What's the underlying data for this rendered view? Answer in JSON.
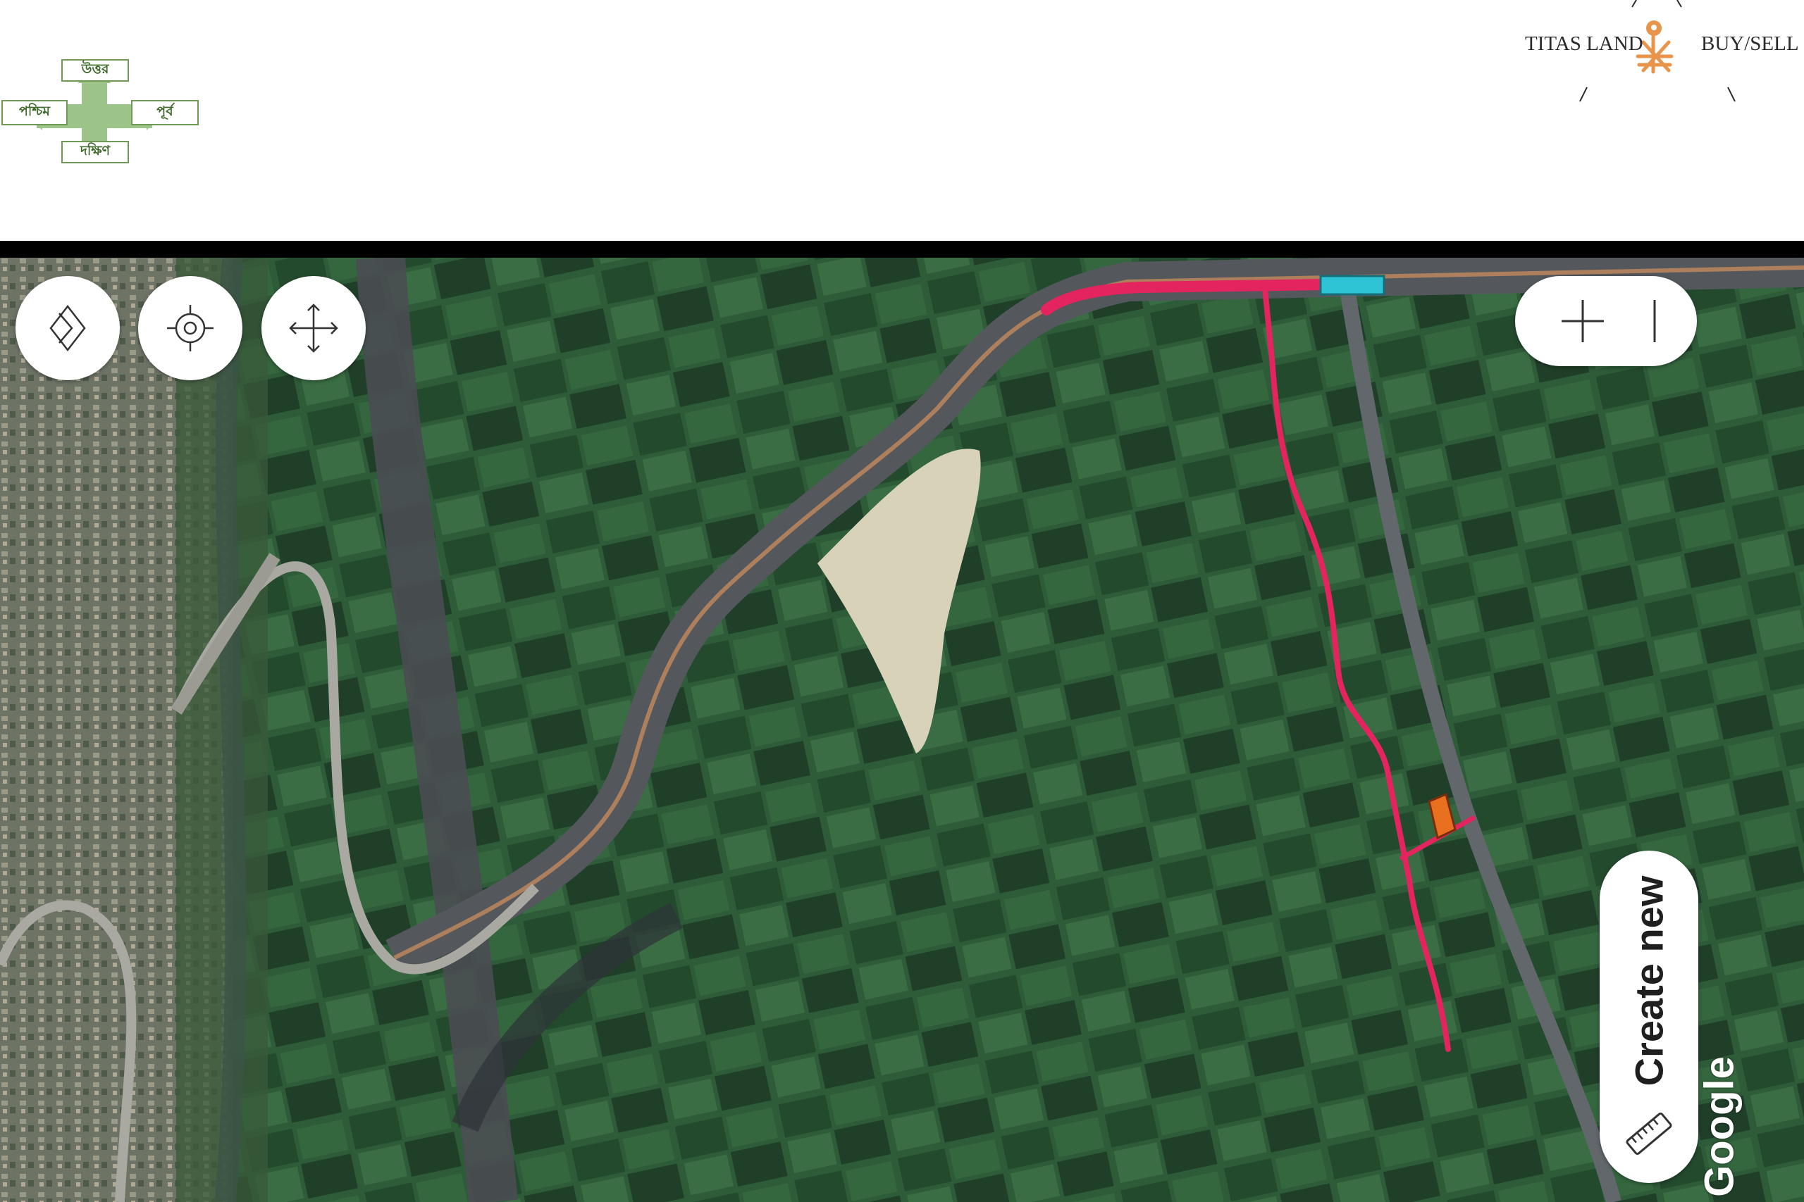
{
  "compass": {
    "north": "উত্তর",
    "south": "দক্ষিণ",
    "east": "পূর্ব",
    "west": "পশ্চিম"
  },
  "logo": {
    "left_text": "TITAS LAND",
    "right_text": "BUY/SELL"
  },
  "map": {
    "type": "satellite",
    "controls": {
      "layers_icon": "diamond-layers-icon",
      "locate_icon": "crosshair-locate-icon",
      "pan_icon": "move-arrows-icon",
      "zoom_in_icon": "plus-icon",
      "zoom_out_icon": "minus-icon"
    },
    "create_new_label": "Create new",
    "create_new_icon": "ruler-icon",
    "attribution": "Google",
    "colors": {
      "route": "#e3245e",
      "start_marker": "#2ec4d6",
      "plot": "#e8701f"
    }
  }
}
